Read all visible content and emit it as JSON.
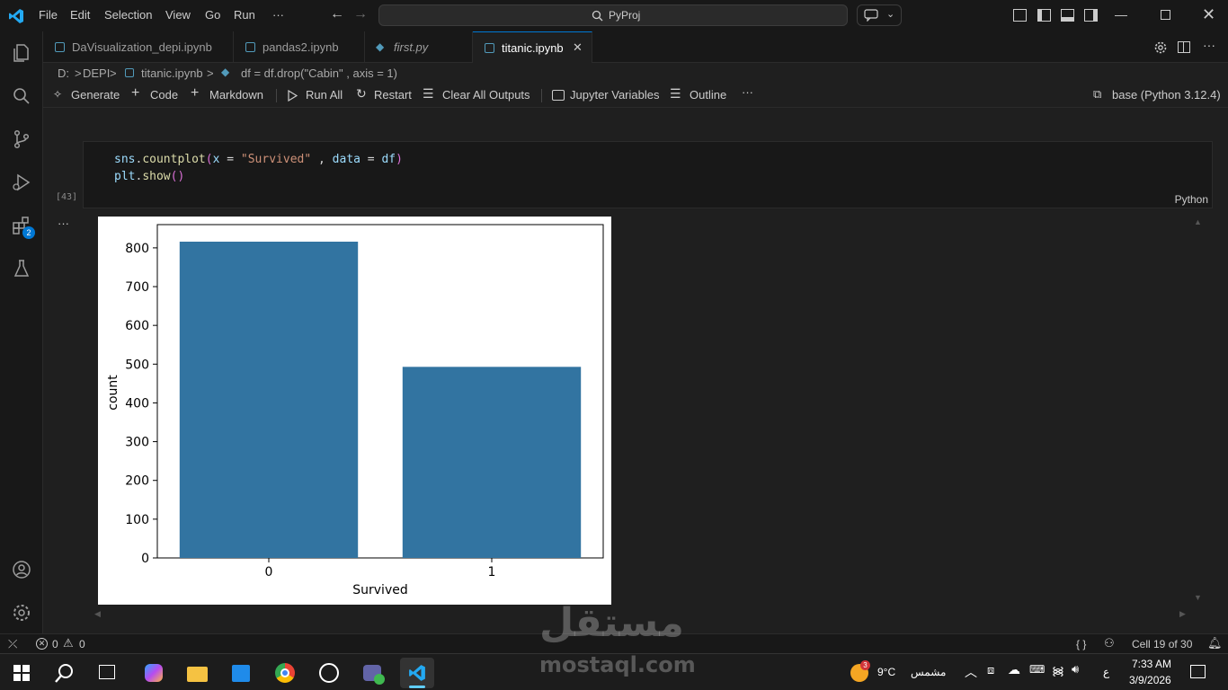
{
  "menu": {
    "file": "File",
    "edit": "Edit",
    "selection": "Selection",
    "view": "View",
    "go": "Go",
    "run": "Run",
    "more": "···"
  },
  "search": {
    "text": "PyProj"
  },
  "tabs": [
    {
      "label": "DaVisualization_depi.ipynb"
    },
    {
      "label": "pandas2.ipynb"
    },
    {
      "label": "first.py"
    },
    {
      "label": "titanic.ipynb"
    }
  ],
  "breadcrumb": {
    "drive": "D:",
    "sep1": ">",
    "folder": "DEPI",
    "sep2": ">",
    "file": "titanic.ipynb",
    "sep3": ">",
    "symbol": "df = df.drop(\"Cabin\" , axis = 1)"
  },
  "toolbar": {
    "generate": "Generate",
    "code": "Code",
    "markdown": "Markdown",
    "run_all": "Run All",
    "restart": "Restart",
    "clear": "Clear All Outputs",
    "variables": "Jupyter Variables",
    "outline": "Outline",
    "more": "···",
    "kernel": "base (Python 3.12.4)"
  },
  "cell": {
    "exec_count": "[43]",
    "lang": "Python",
    "line1": {
      "a": "sns",
      "b": ".",
      "c": "countplot",
      "d": "(",
      "e": "x",
      "f": " = ",
      "g": "\"Survived\"",
      "h": " , ",
      "i": "data",
      "j": " = ",
      "k": "df",
      "l": ")"
    },
    "line2": {
      "a": "plt",
      "b": ".",
      "c": "show",
      "d": "()"
    },
    "output_more": "···"
  },
  "activity_badge": "2",
  "chart_data": {
    "type": "bar",
    "categories": [
      "0",
      "1"
    ],
    "values": [
      816,
      493
    ],
    "xlabel": "Survived",
    "ylabel": "count",
    "ylim": [
      0,
      860
    ],
    "yticks": [
      0,
      100,
      200,
      300,
      400,
      500,
      600,
      700,
      800
    ],
    "bar_color": "#3274a1"
  },
  "statusbar": {
    "errors": "0",
    "warnings": "0",
    "braces": "{ }",
    "cell": "Cell 19 of 30"
  },
  "taskbar": {
    "temp": "9°C",
    "weather_text": "مشمس",
    "weather_badge": "3",
    "lang": "ع",
    "time": "7:33 AM",
    "date": "3/9/2026"
  },
  "watermark": {
    "arabic": "مستقل",
    "latin": "mostaql.com"
  },
  "colors": {
    "accent": "#0078d4",
    "bg": "#1f1f1f",
    "bar": "#3274a1"
  }
}
